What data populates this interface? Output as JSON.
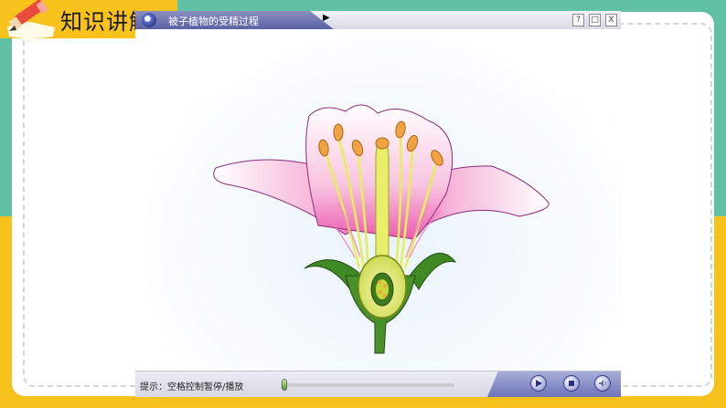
{
  "slide": {
    "section_title": "知识讲解"
  },
  "player": {
    "title": "被子植物的受精过程",
    "help_label": "?",
    "restore_label": "□",
    "close_label": "X",
    "hint": "提示：空格控制暂停/播放",
    "progress": 0.02,
    "controls": {
      "play_icon": "play-icon",
      "stop_icon": "stop-icon",
      "sound_icon": "speaker-icon"
    }
  },
  "colors": {
    "teal": "#5fc0a3",
    "yellow": "#f8c21c",
    "accent_purple": "#5b62a3"
  }
}
